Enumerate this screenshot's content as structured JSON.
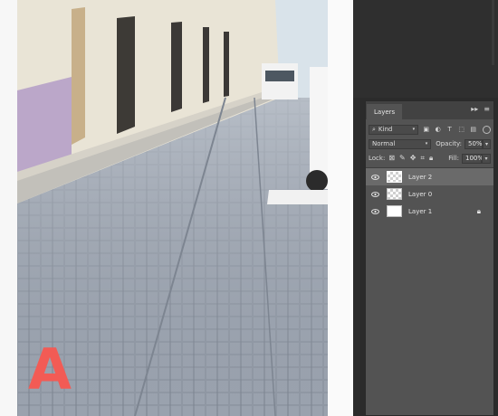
{
  "panel": {
    "tab": "Layers",
    "collapse": "▸▸",
    "menu": "≡",
    "filter_kind": "Kind",
    "blend_mode": "Normal",
    "opacity_label": "Opacity:",
    "opacity_value": "50%",
    "lock_label": "Lock:",
    "fill_label": "Fill:",
    "fill_value": "100%"
  },
  "layers": [
    {
      "name": "Layer 2",
      "selected": true,
      "visible": true,
      "thumb": "checker"
    },
    {
      "name": "Layer 0",
      "selected": false,
      "visible": true,
      "thumb": "checker"
    },
    {
      "name": "Layer 1",
      "selected": false,
      "visible": true,
      "thumb": "white",
      "locked": true
    }
  ],
  "canvas": {
    "scrawl": "A"
  }
}
